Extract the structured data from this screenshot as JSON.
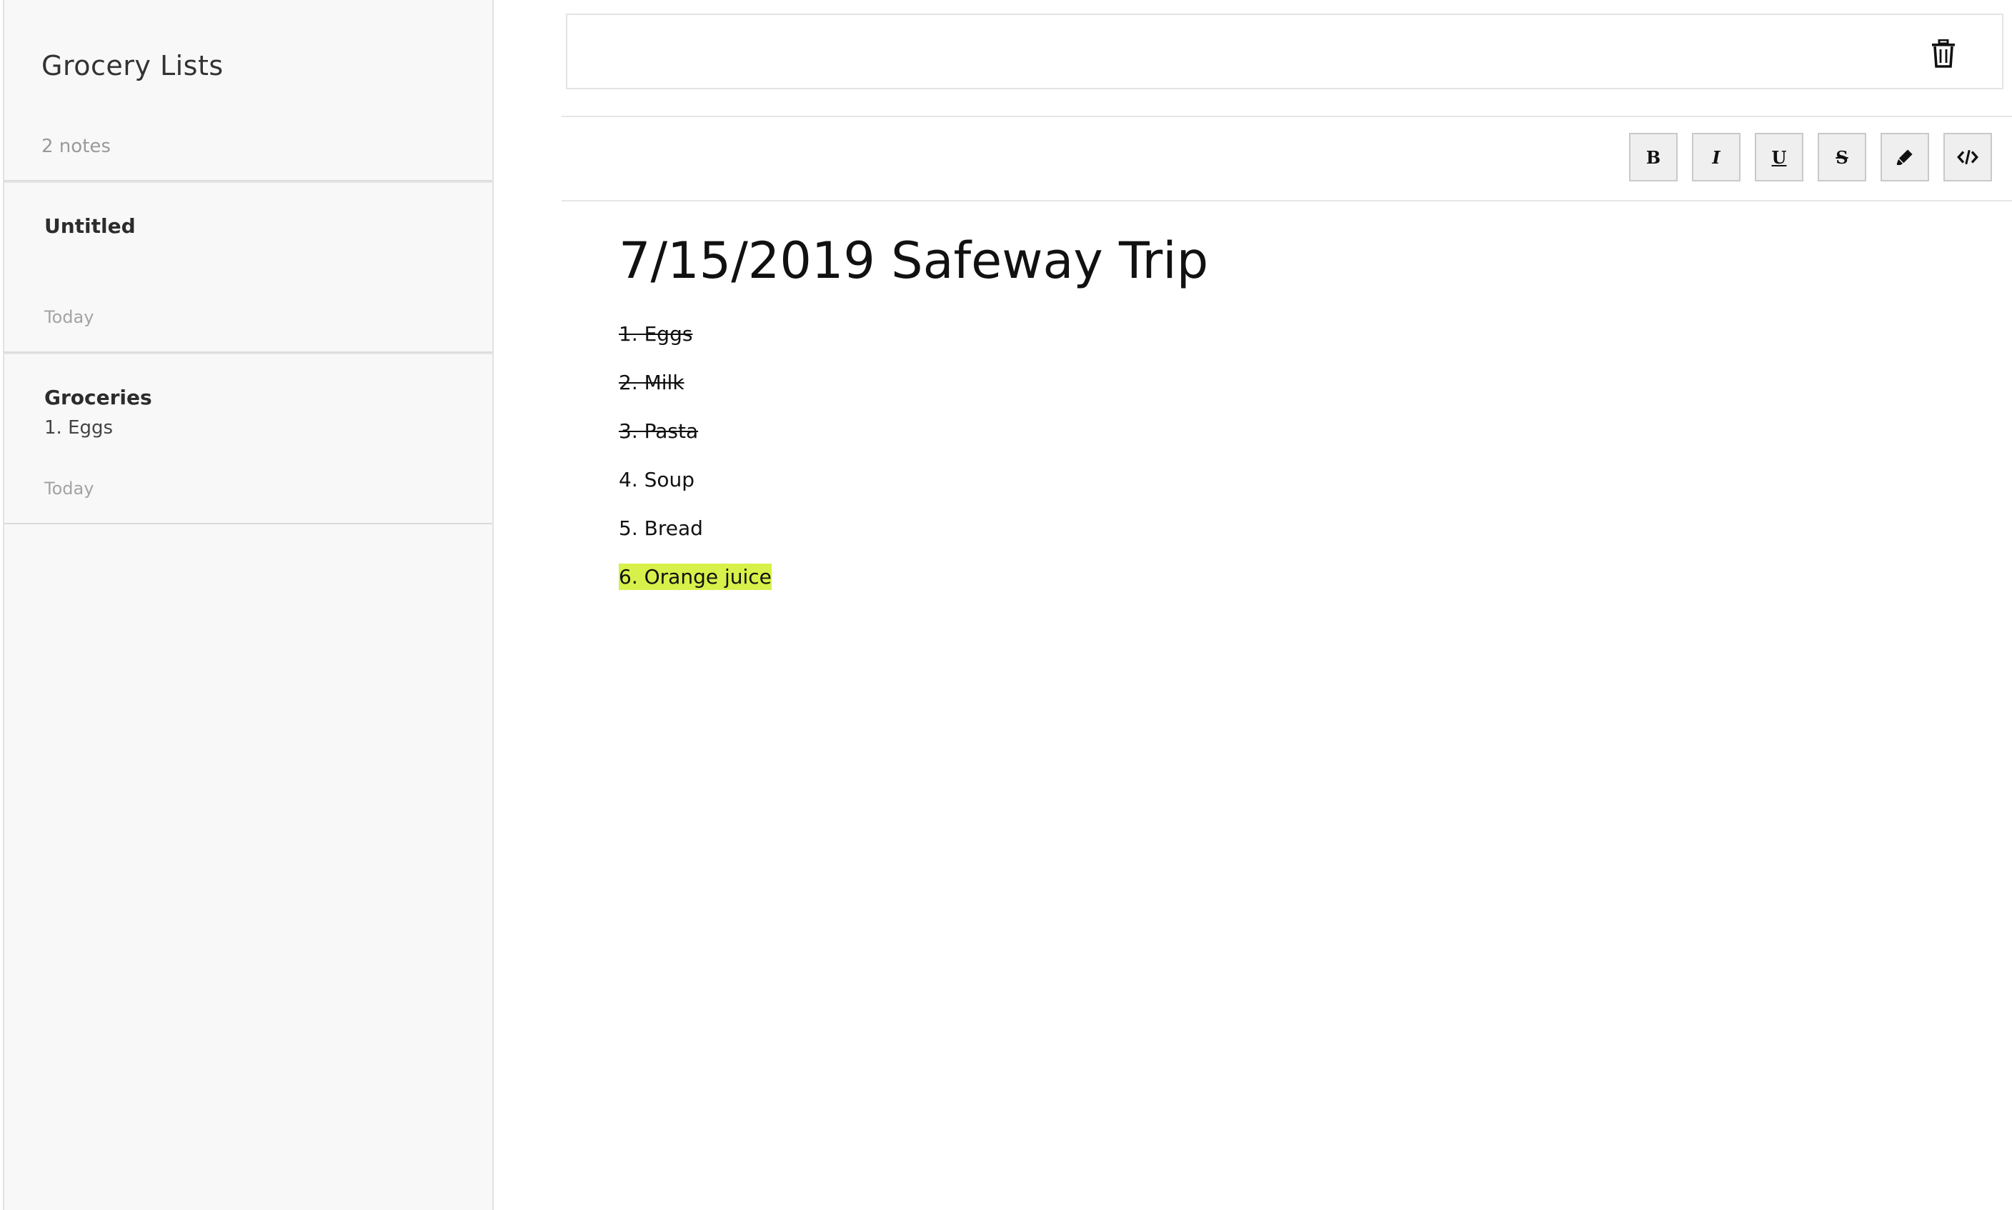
{
  "sidebar": {
    "title": "Grocery Lists",
    "count": "2 notes",
    "notes": [
      {
        "title": "Untitled",
        "preview": "",
        "date": "Today"
      },
      {
        "title": "Groceries",
        "preview": "1. Eggs",
        "date": "Today"
      }
    ]
  },
  "toolbar": {
    "bold": "B",
    "italic": "I",
    "underline": "U",
    "strike": "S"
  },
  "editor": {
    "title": "7/15/2019 Safeway Trip",
    "lines": [
      {
        "text": "1. Eggs",
        "style": "strikethrough"
      },
      {
        "text": "2. Milk",
        "style": "strikethrough"
      },
      {
        "text": "3. Pasta",
        "style": "strikethrough"
      },
      {
        "text": "4. Soup",
        "style": "normal"
      },
      {
        "text": "5. Bread",
        "style": "normal"
      },
      {
        "text": "6. Orange juice",
        "style": "highlight"
      }
    ]
  },
  "colors": {
    "highlight": "#d8f04a",
    "sidebar_bg": "#f8f8f8"
  },
  "icons": {
    "trash": "trash-icon",
    "highlight": "highlighter-icon",
    "code": "code-icon"
  }
}
